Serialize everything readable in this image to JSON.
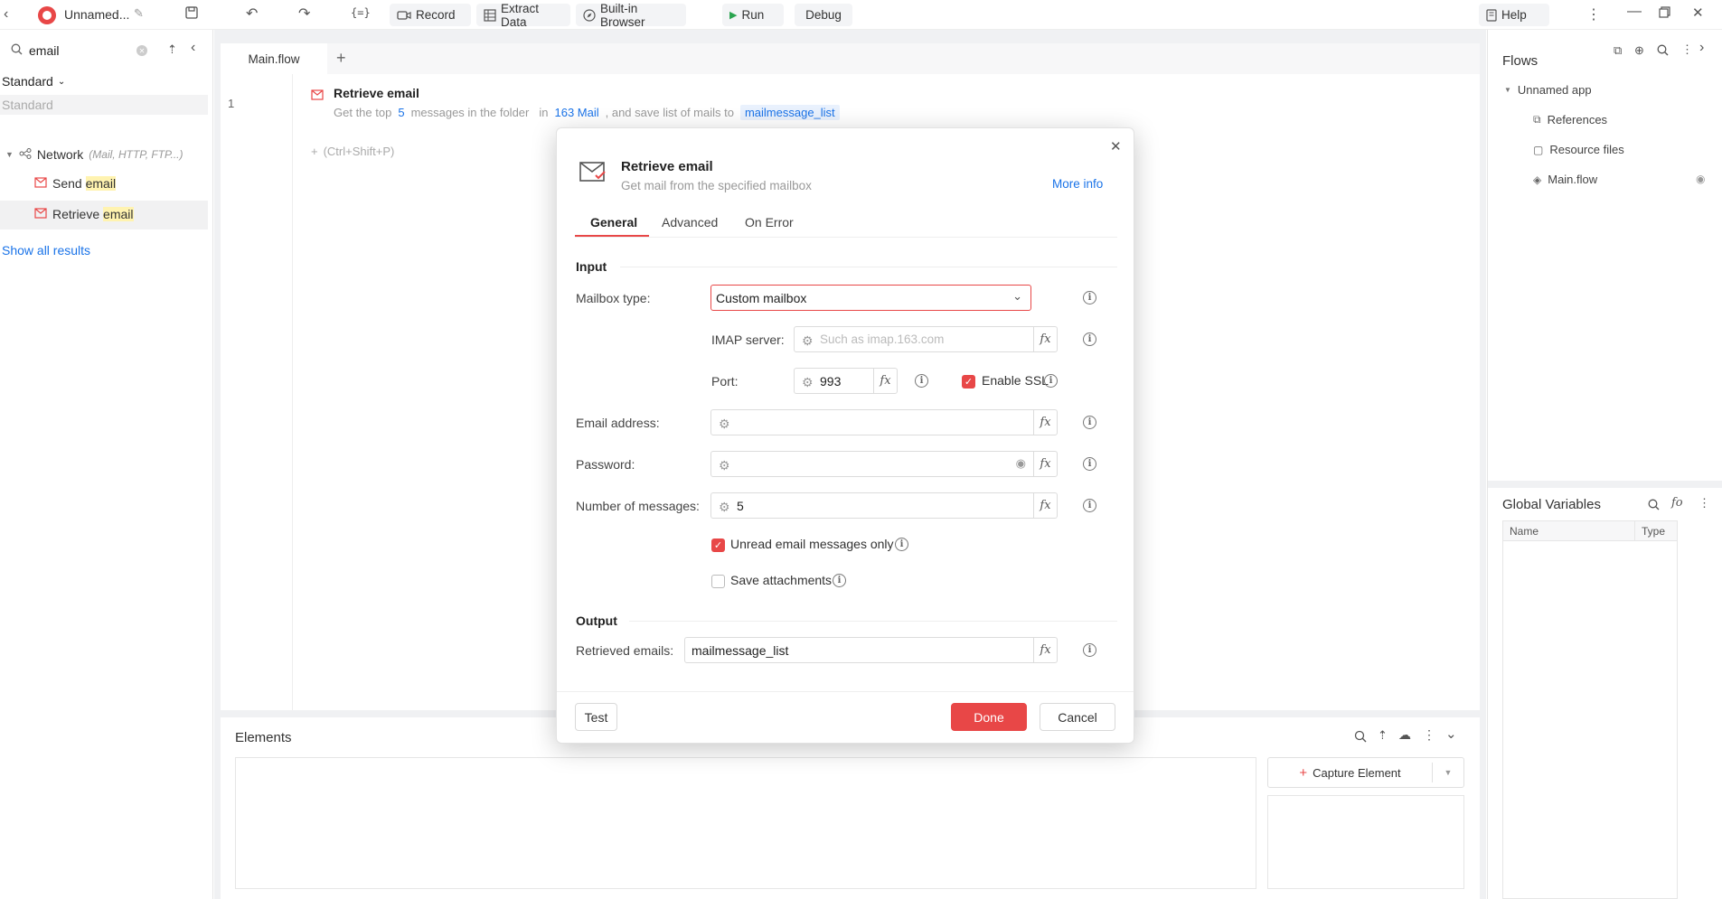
{
  "toolbar": {
    "app_title": "Unnamed...",
    "record": "Record",
    "extract_data": "Extract Data",
    "builtin_browser": "Built-in Browser",
    "run": "Run",
    "debug": "Debug",
    "help": "Help"
  },
  "left": {
    "search_value": "email",
    "category_dropdown": "Standard",
    "section_label": "Standard",
    "tree_network": "Network",
    "tree_network_hint": "(Mail, HTTP, FTP...)",
    "item_send_prefix": "Send ",
    "item_send_hl": "email",
    "item_retrieve_prefix": "Retrieve ",
    "item_retrieve_hl": "email",
    "show_all": "Show all results"
  },
  "editor": {
    "tab": "Main.flow",
    "line_number": "1",
    "step_title": "Retrieve email",
    "step_desc_1": "Get the top",
    "step_desc_count": "5",
    "step_desc_2": "messages in the folder",
    "step_desc_in": "in",
    "step_desc_folder": "163 Mail",
    "step_desc_3": ", and save list of mails to",
    "step_desc_var": "mailmessage_list",
    "add_hint": "(Ctrl+Shift+P)"
  },
  "elements": {
    "title": "Elements",
    "capture": "Capture Element"
  },
  "right": {
    "flows_title": "Flows",
    "app_node": "Unnamed app",
    "references": "References",
    "resource_files": "Resource files",
    "main_flow": "Main.flow",
    "globals_title": "Global Variables",
    "col_name": "Name",
    "col_type": "Type"
  },
  "dialog": {
    "title": "Retrieve email",
    "subtitle": "Get mail from the specified mailbox",
    "more_info": "More info",
    "tabs": [
      "General",
      "Advanced",
      "On Error"
    ],
    "section_input": "Input",
    "mailbox_type_label": "Mailbox type:",
    "mailbox_type_value": "Custom mailbox",
    "imap_label": "IMAP server:",
    "imap_placeholder": "Such as imap.163.com",
    "port_label": "Port:",
    "port_value": "993",
    "ssl_label": "Enable SSL",
    "email_label": "Email address:",
    "password_label": "Password:",
    "num_label": "Number of messages:",
    "num_value": "5",
    "unread_label": "Unread email messages only",
    "attachments_label": "Save attachments",
    "section_output": "Output",
    "retrieved_label": "Retrieved emails:",
    "retrieved_value": "mailmessage_list",
    "test": "Test",
    "done": "Done",
    "cancel": "Cancel"
  },
  "colors": {
    "accent": "#e84747",
    "link": "#1a73e8"
  }
}
